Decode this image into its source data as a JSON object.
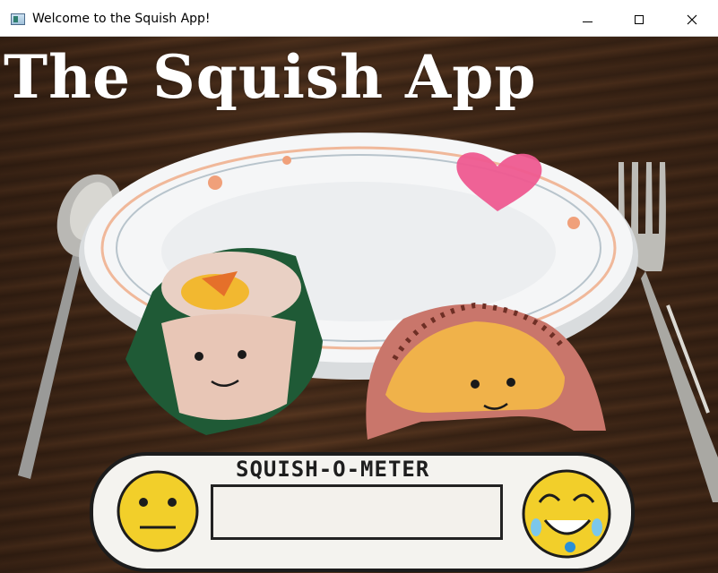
{
  "window": {
    "title": "Welcome to the Squish App!",
    "icon": "app-window-icon"
  },
  "window_controls": {
    "minimize_icon": "minimize-icon",
    "maximize_icon": "maximize-icon",
    "close_icon": "close-icon"
  },
  "app": {
    "title": "The Squish App"
  },
  "scene": {
    "utensils": [
      "spoon",
      "fork"
    ],
    "plate": "plate",
    "characters": [
      "sushi-roll-character",
      "dumpling-character"
    ],
    "decoration": "heart-icon"
  },
  "squish_meter": {
    "label": "SQUISH-O-METER",
    "left_icon": "neutral-face-icon",
    "right_icon": "happy-crying-face-icon",
    "level": 0
  },
  "colors": {
    "heart": "#ee5a90",
    "face": "#f2cf2a",
    "title_text": "#ffffff"
  }
}
